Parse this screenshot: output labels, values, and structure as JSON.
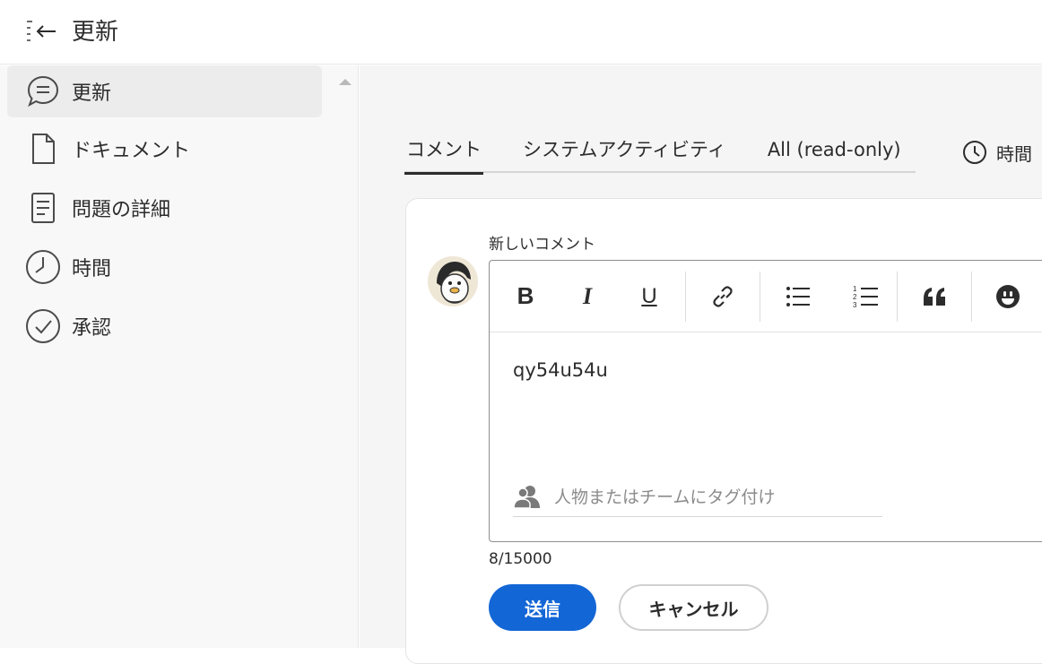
{
  "header": {
    "title": "更新",
    "collapse_icon": "panel-collapse-left-icon"
  },
  "sidebar": {
    "items": [
      {
        "label": "更新",
        "icon": "comment-icon",
        "active": true
      },
      {
        "label": "ドキュメント",
        "icon": "document-icon",
        "active": false
      },
      {
        "label": "問題の詳細",
        "icon": "details-icon",
        "active": false
      },
      {
        "label": "時間",
        "icon": "clock-icon",
        "active": false
      },
      {
        "label": "承認",
        "icon": "checkmark-circle-icon",
        "active": false
      }
    ]
  },
  "main": {
    "tabs": [
      {
        "label": "コメント",
        "selected": true
      },
      {
        "label": "システムアクティビティ",
        "selected": false
      },
      {
        "label": "All (read-only)",
        "selected": false
      }
    ],
    "time_filter_label": "時間"
  },
  "comment_form": {
    "label": "新しいコメント",
    "toolbar": [
      "B",
      "I",
      "U",
      "link",
      "bullet-list",
      "numbered-list",
      "quote",
      "emoji"
    ],
    "text": "qy54u54u",
    "tag_placeholder": "人物またはチームにタグ付け",
    "char_count": "8/15000",
    "submit_label": "送信",
    "cancel_label": "キャンセル"
  },
  "colors": {
    "primary": "#1366d6",
    "sidebar_bg": "#f8f8f8",
    "main_bg": "#f5f5f5"
  }
}
